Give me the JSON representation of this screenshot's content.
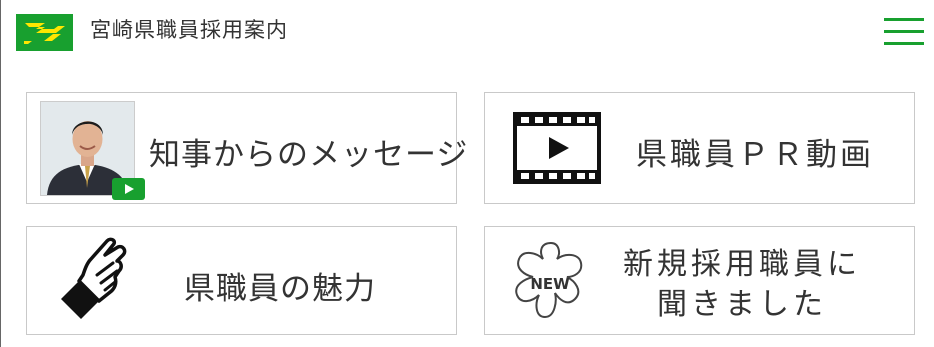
{
  "header": {
    "site_title": "宮崎県職員採用案内",
    "logo_icon": "miyazaki-prefecture-logo",
    "menu_icon": "hamburger-menu-icon",
    "accent_color": "#18a02f"
  },
  "cards": [
    {
      "label": "知事からのメッセージ",
      "icon": "governor-photo"
    },
    {
      "label": "県職員ＰＲ動画",
      "icon": "film-play-icon"
    },
    {
      "label": "県職員の魅力",
      "icon": "pointing-hand-icon"
    },
    {
      "label": "新規採用職員に\n聞きました",
      "icon": "new-flower-icon",
      "badge_text": "NEW"
    }
  ]
}
